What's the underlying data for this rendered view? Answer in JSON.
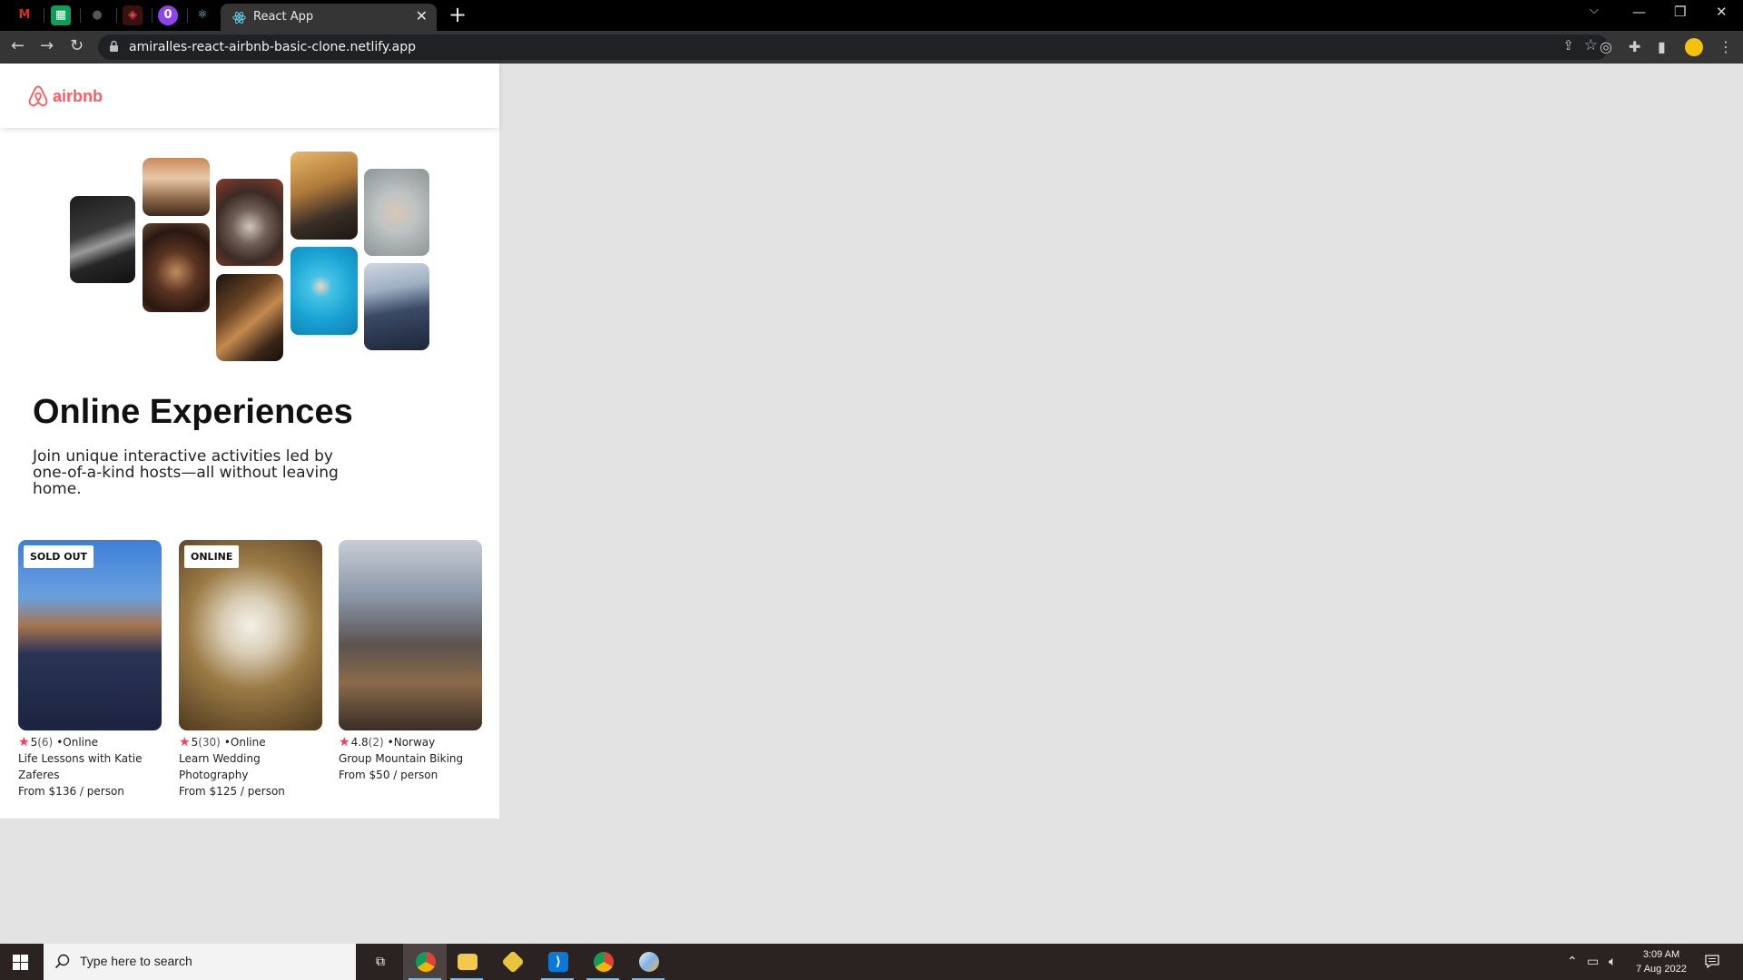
{
  "browser": {
    "active_tab_title": "React App",
    "url": "amiralles-react-airbnb-basic-clone.netlify.app",
    "pinned_tabs": [
      {
        "name": "gmail-icon",
        "glyph": "M",
        "color": "#d93025",
        "bg": "#000"
      },
      {
        "name": "sheets-icon",
        "glyph": "T",
        "color": "#fff",
        "bg": "#0f9d58"
      },
      {
        "name": "github-icon",
        "glyph": "●",
        "color": "#555",
        "bg": "#000"
      },
      {
        "name": "codepen-icon",
        "glyph": "◈",
        "color": "#e34a4a",
        "bg": "#3a1010"
      },
      {
        "name": "purple-app-icon",
        "glyph": "0",
        "color": "#fff",
        "bg": "#8e44ec"
      },
      {
        "name": "react-tab-icon",
        "glyph": "⚛",
        "color": "#61dafb",
        "bg": "#000"
      }
    ]
  },
  "app": {
    "logo_text": "airbnb",
    "hero": {
      "title": "Online Experiences",
      "subtitle": "Join unique interactive activities led by one-of-a-kind hosts—all without leaving home."
    },
    "cards": [
      {
        "badge": "SOLD OUT",
        "rating": "5",
        "review_count": "(6)",
        "location": "•Online",
        "title": "Life Lessons with Katie Zaferes",
        "price": "From $136 / person"
      },
      {
        "badge": "ONLINE",
        "rating": "5",
        "review_count": "(30)",
        "location": "•Online",
        "title": "Learn Wedding Photography",
        "price": "From $125 / person"
      },
      {
        "badge": "",
        "rating": "4.8",
        "review_count": "(2)",
        "location": "•Norway",
        "title": "Group Mountain Biking",
        "price": "From $50 / person"
      }
    ]
  },
  "taskbar": {
    "search_placeholder": "Type here to search",
    "time": "3:09 AM",
    "date": "7 Aug 2022"
  },
  "colors": {
    "brand": "#FF5A5F",
    "star": "#FE395C"
  }
}
